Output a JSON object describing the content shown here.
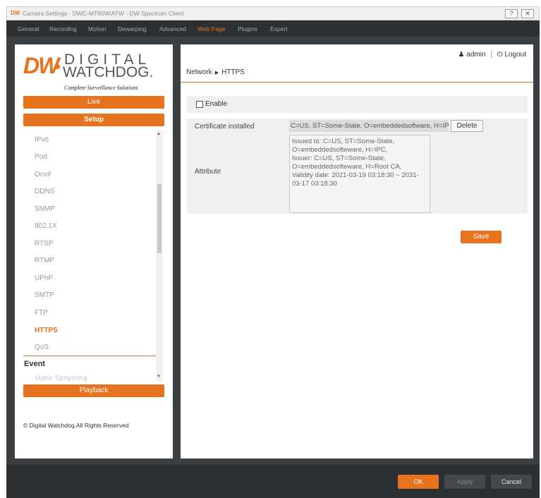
{
  "window": {
    "app_icon_text": "DW",
    "title": "Camera Settings - DWC-MT95WiATW - DW Spectrum Client",
    "help_icon": "?",
    "close_icon": "✕"
  },
  "main_tabs": [
    {
      "label": "General"
    },
    {
      "label": "Recording"
    },
    {
      "label": "Motion"
    },
    {
      "label": "Dewarping"
    },
    {
      "label": "Advanced"
    },
    {
      "label": "Web Page"
    },
    {
      "label": "Plugins"
    },
    {
      "label": "Expert"
    }
  ],
  "active_tab": "Web Page",
  "logo": {
    "mark": "DW",
    "line1": "DIGITAL",
    "line2": "WATCHDOG.",
    "tagline": "Complete Surveillance Solutions"
  },
  "nav": {
    "live": "Live",
    "setup": "Setup",
    "playback": "Playback"
  },
  "submenu": {
    "items": [
      {
        "label": "IPv6"
      },
      {
        "label": "Port"
      },
      {
        "label": "Onvif"
      },
      {
        "label": "DDNS"
      },
      {
        "label": "SNMP"
      },
      {
        "label": "802.1X"
      },
      {
        "label": "RTSP"
      },
      {
        "label": "RTMP"
      },
      {
        "label": "UPnP"
      },
      {
        "label": "SMTP"
      },
      {
        "label": "FTP"
      },
      {
        "label": "HTTPS"
      },
      {
        "label": "QoS"
      }
    ],
    "active": "HTTPS",
    "section": "Event",
    "partial_item": "Video Tampering"
  },
  "copyright": "© Digital Watchdog.All Rights Reserved",
  "user": {
    "name": "admin",
    "separator": "|",
    "logout": "Logout"
  },
  "breadcrumb": {
    "parent": "Network",
    "current": "HTTPS"
  },
  "form": {
    "enable_label": "Enable",
    "enable_checked": false,
    "cert_label": "Certificate installed",
    "cert_value": "C=US, ST=Some-State, O=embeddedsoftware, H=IPC",
    "delete_label": "Delete",
    "attribute_label": "Attribute",
    "attribute_text": "Issued to: C=US, ST=Some-State, O=embeddedsofteware, H=IPC,\nIssuer: C=US, ST=Some-State, O=embeddedsofteware, H=Root CA,\nValidity date: 2021-03-19 03:18:30 ~ 2031-03-17 03:18:30",
    "save_label": "Save"
  },
  "footer": {
    "ok": "OK",
    "apply": "Apply",
    "cancel": "Cancel"
  },
  "colors": {
    "accent": "#e8731f",
    "dark_bar": "#2d3033",
    "frame": "#3b3e42"
  }
}
